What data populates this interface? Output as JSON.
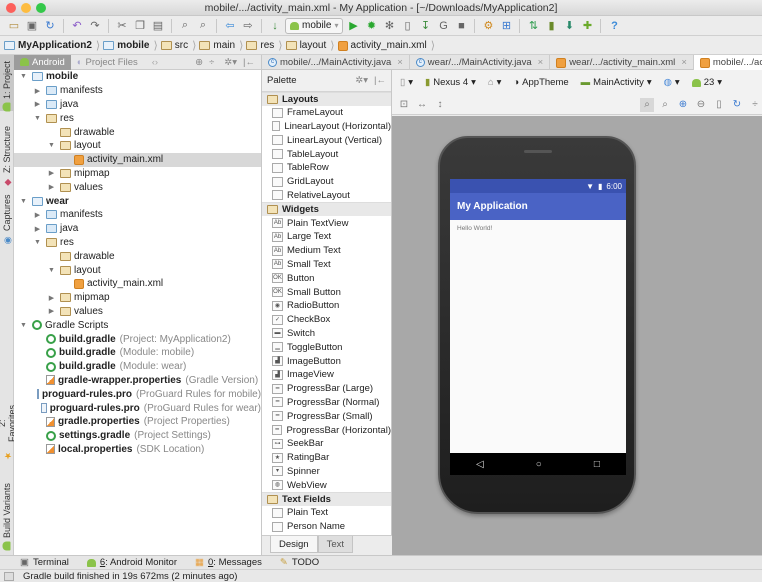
{
  "window": {
    "title": "mobile/.../activity_main.xml - My Application - [~/Downloads/MyApplication2]",
    "traffic_lights": [
      "#fc605b",
      "#fdbc40",
      "#34c84a"
    ]
  },
  "toolbar": {
    "run_config": "mobile",
    "icons": [
      "open-icon",
      "save-icon",
      "sync-icon",
      "undo-icon",
      "redo-icon",
      "cut-icon",
      "copy-icon",
      "paste-icon",
      "find-icon",
      "replace-icon",
      "back-icon",
      "forward-icon",
      "make-icon",
      "run-icon",
      "debug-icon",
      "attach-debugger-icon",
      "stop-icon",
      "stop-all-icon",
      "project-structure-icon",
      "sdk-manager-icon",
      "avd-manager-icon",
      "gradle-sync-icon",
      "device-monitor-icon",
      "android-icon",
      "help-icon"
    ]
  },
  "breadcrumb": [
    {
      "label": "MyApplication2",
      "bold": true
    },
    {
      "label": "mobile",
      "bold": true
    },
    {
      "label": "src"
    },
    {
      "label": "main"
    },
    {
      "label": "res"
    },
    {
      "label": "layout"
    },
    {
      "label": "activity_main.xml"
    }
  ],
  "left_strip": {
    "project": "1: Project",
    "structure": "Z: Structure",
    "captures": "Captures",
    "favorites": "2: Favorites",
    "build_variants": "Build Variants"
  },
  "project_panel": {
    "tabs": [
      "Android",
      "Project Files"
    ],
    "tree": [
      {
        "label": "mobile",
        "level": 0,
        "arrow": "down",
        "icon": "module",
        "bold": true
      },
      {
        "label": "manifests",
        "level": 1,
        "arrow": "right",
        "icon": "folder-blue"
      },
      {
        "label": "java",
        "level": 1,
        "arrow": "right",
        "icon": "folder-blue"
      },
      {
        "label": "res",
        "level": 1,
        "arrow": "down",
        "icon": "folder-res"
      },
      {
        "label": "drawable",
        "level": 2,
        "arrow": "",
        "icon": "folder"
      },
      {
        "label": "layout",
        "level": 2,
        "arrow": "down",
        "icon": "folder"
      },
      {
        "label": "activity_main.xml",
        "level": 3,
        "arrow": "",
        "icon": "xml",
        "selected": true
      },
      {
        "label": "mipmap",
        "level": 2,
        "arrow": "right",
        "icon": "folder"
      },
      {
        "label": "values",
        "level": 2,
        "arrow": "right",
        "icon": "folder"
      },
      {
        "label": "wear",
        "level": 0,
        "arrow": "down",
        "icon": "module",
        "bold": true
      },
      {
        "label": "manifests",
        "level": 1,
        "arrow": "right",
        "icon": "folder-blue"
      },
      {
        "label": "java",
        "level": 1,
        "arrow": "right",
        "icon": "folder-blue"
      },
      {
        "label": "res",
        "level": 1,
        "arrow": "down",
        "icon": "folder-res"
      },
      {
        "label": "drawable",
        "level": 2,
        "arrow": "",
        "icon": "folder"
      },
      {
        "label": "layout",
        "level": 2,
        "arrow": "down",
        "icon": "folder"
      },
      {
        "label": "activity_main.xml",
        "level": 3,
        "arrow": "",
        "icon": "xml"
      },
      {
        "label": "mipmap",
        "level": 2,
        "arrow": "right",
        "icon": "folder"
      },
      {
        "label": "values",
        "level": 2,
        "arrow": "right",
        "icon": "folder"
      },
      {
        "label": "Gradle Scripts",
        "level": 0,
        "arrow": "down",
        "icon": "gradle"
      },
      {
        "label": "build.gradle",
        "hint": "(Project: MyApplication2)",
        "level": 1,
        "arrow": "",
        "icon": "gradle",
        "bold": true
      },
      {
        "label": "build.gradle",
        "hint": "(Module: mobile)",
        "level": 1,
        "arrow": "",
        "icon": "gradle",
        "bold": true
      },
      {
        "label": "build.gradle",
        "hint": "(Module: wear)",
        "level": 1,
        "arrow": "",
        "icon": "gradle",
        "bold": true
      },
      {
        "label": "gradle-wrapper.properties",
        "hint": "(Gradle Version)",
        "level": 1,
        "arrow": "",
        "icon": "properties",
        "bold": true
      },
      {
        "label": "proguard-rules.pro",
        "hint": "(ProGuard Rules for mobile)",
        "level": 1,
        "arrow": "",
        "icon": "pro",
        "bold": true
      },
      {
        "label": "proguard-rules.pro",
        "hint": "(ProGuard Rules for wear)",
        "level": 1,
        "arrow": "",
        "icon": "pro",
        "bold": true
      },
      {
        "label": "gradle.properties",
        "hint": "(Project Properties)",
        "level": 1,
        "arrow": "",
        "icon": "properties",
        "bold": true
      },
      {
        "label": "settings.gradle",
        "hint": "(Project Settings)",
        "level": 1,
        "arrow": "",
        "icon": "gradle",
        "bold": true
      },
      {
        "label": "local.properties",
        "hint": "(SDK Location)",
        "level": 1,
        "arrow": "",
        "icon": "properties",
        "bold": true
      }
    ]
  },
  "editor_tabs": [
    {
      "label": "mobile/.../MainActivity.java",
      "icon": "class"
    },
    {
      "label": "wear/.../MainActivity.java",
      "icon": "class"
    },
    {
      "label": "wear/.../activity_main.xml",
      "icon": "xml"
    },
    {
      "label": "mobile/.../activity_main.xml",
      "icon": "xml",
      "active": true
    }
  ],
  "palette": {
    "title": "Palette",
    "groups": [
      {
        "name": "Layouts",
        "items": [
          "FrameLayout",
          "LinearLayout (Horizontal)",
          "LinearLayout (Vertical)",
          "TableLayout",
          "TableRow",
          "GridLayout",
          "RelativeLayout"
        ]
      },
      {
        "name": "Widgets",
        "items": [
          "Plain TextView",
          "Large Text",
          "Medium Text",
          "Small Text",
          "Button",
          "Small Button",
          "RadioButton",
          "CheckBox",
          "Switch",
          "ToggleButton",
          "ImageButton",
          "ImageView",
          "ProgressBar (Large)",
          "ProgressBar (Normal)",
          "ProgressBar (Small)",
          "ProgressBar (Horizontal)",
          "SeekBar",
          "RatingBar",
          "Spinner",
          "WebView"
        ]
      },
      {
        "name": "Text Fields",
        "items": [
          "Plain Text",
          "Person Name"
        ]
      }
    ],
    "tabs": [
      "Design",
      "Text"
    ],
    "active_tab": "Design"
  },
  "layout_toolbar": {
    "device": "Nexus 4",
    "theme": "AppTheme",
    "activity": "MainActivity",
    "api": "23"
  },
  "preview": {
    "status_time": "6:00",
    "app_title": "My Application",
    "body_text": "Hello World!",
    "appbar_color": "#4a63c5",
    "statusbar_color": "#3a52b0"
  },
  "bottom_tabs": [
    {
      "prefix": "",
      "label": "Terminal"
    },
    {
      "prefix": "6",
      "label": ": Android Monitor"
    },
    {
      "prefix": "0",
      "label": ": Messages"
    },
    {
      "prefix": "",
      "label": "TODO"
    }
  ],
  "status": {
    "message": "Gradle build finished in 19s 672ms (2 minutes ago)"
  }
}
